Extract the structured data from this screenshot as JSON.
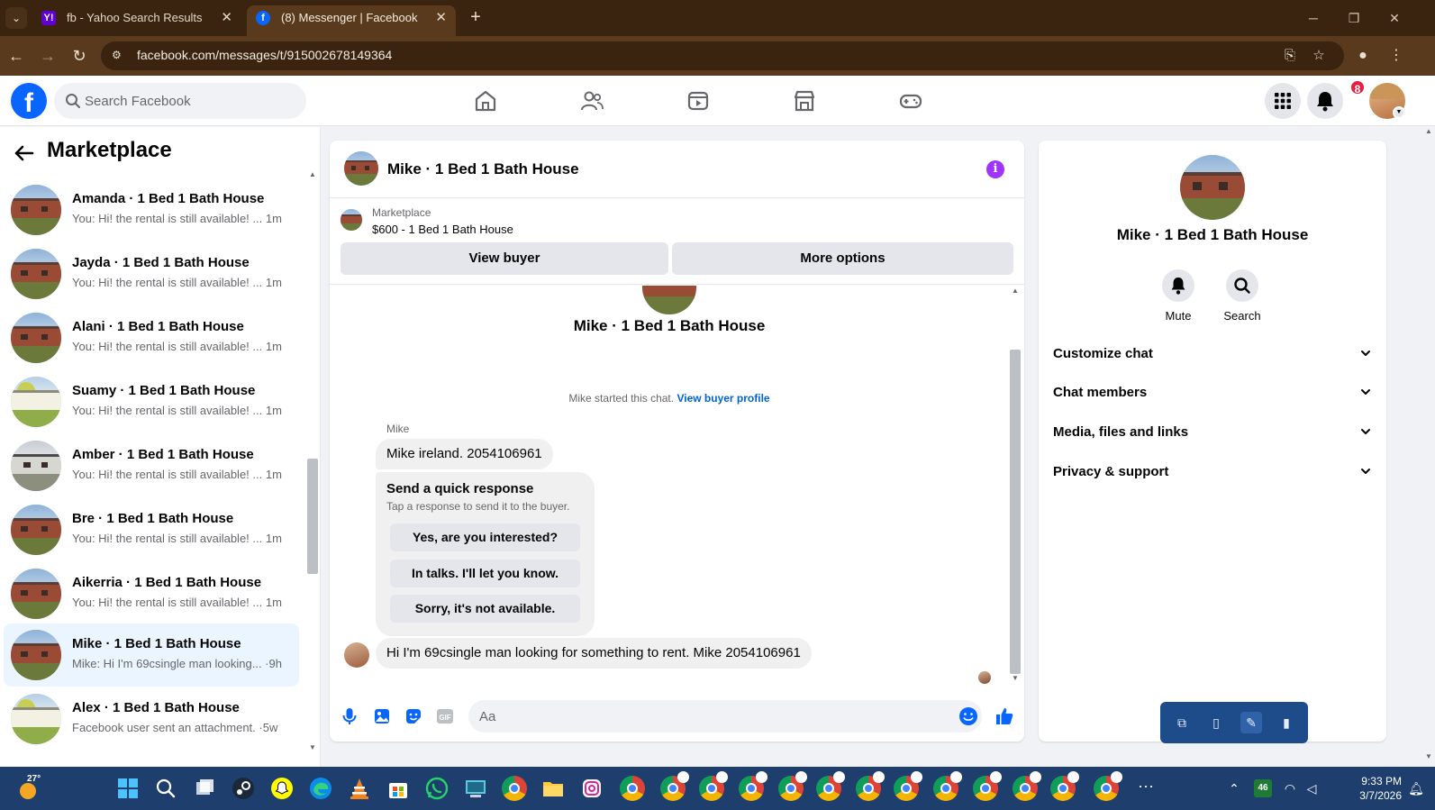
{
  "browser": {
    "tabs": [
      {
        "title": "fb - Yahoo Search Results",
        "favicon": "Y!"
      },
      {
        "title": "(8) Messenger | Facebook",
        "favicon": "f"
      }
    ],
    "url": "facebook.com/messages/t/915002678149364"
  },
  "header": {
    "logo": "f",
    "search_placeholder": "Search Facebook",
    "notification_count": "8"
  },
  "sidebar": {
    "title": "Marketplace",
    "conversations": [
      {
        "name": "Amanda · 1 Bed 1 Bath House",
        "preview": "You: Hi! the rental is still available! ... 1m"
      },
      {
        "name": "Jayda · 1 Bed 1 Bath House",
        "preview": "You: Hi! the rental is still available! ... 1m"
      },
      {
        "name": "Alani · 1 Bed 1 Bath House",
        "preview": "You: Hi! the rental is still available! ... 1m"
      },
      {
        "name": "Suamy · 1 Bed 1 Bath House",
        "preview": "You: Hi! the rental is still available! ... 1m"
      },
      {
        "name": "Amber · 1 Bed 1 Bath House",
        "preview": "You: Hi! the rental is still available! ... 1m"
      },
      {
        "name": "Bre · 1 Bed 1 Bath House",
        "preview": "You: Hi! the rental is still available! ... 1m"
      },
      {
        "name": "Aikerria · 1 Bed 1 Bath House",
        "preview": "You: Hi! the rental is still available! ... 1m"
      },
      {
        "name": "Mike · 1 Bed 1 Bath House",
        "preview": "Mike: Hi I'm 69csingle man looking... ·9h"
      },
      {
        "name": "Alex · 1 Bed 1 Bath House",
        "preview": "Facebook user sent an attachment. ·5w"
      }
    ]
  },
  "chat": {
    "title": "Mike · 1 Bed 1 Bath House",
    "marketplace_label": "Marketplace",
    "listing": "$600 - 1 Bed 1 Bath House",
    "view_buyer": "View buyer",
    "more_options": "More options",
    "center_name": "Mike · 1 Bed 1 Bath House",
    "started_text": "Mike started this chat.",
    "view_buyer_profile": "View buyer profile",
    "sender": "Mike",
    "message1": "Mike ireland. 2054106961",
    "quick_title": "Send a quick response",
    "quick_sub": "Tap a response to send it to the buyer.",
    "quick_options": [
      "Yes, are you interested?",
      "In talks. I'll let you know.",
      "Sorry, it's not available."
    ],
    "message2": "Hi I'm 69csingle man looking for something to rent.  Mike 2054106961",
    "input_placeholder": "Aa"
  },
  "right_panel": {
    "name": "Mike · 1 Bed 1 Bath House",
    "mute": "Mute",
    "search": "Search",
    "sections": [
      "Customize chat",
      "Chat members",
      "Media, files and links",
      "Privacy & support"
    ]
  },
  "taskbar": {
    "temperature": "27°",
    "tray_badge": "46",
    "time": "9:33 PM",
    "date": "3/7/2026"
  },
  "colors": {
    "fb_blue": "#0866ff",
    "browser_frame": "#5a3a1c",
    "taskbar": "#1e3f6e",
    "selected_row": "#ebf5ff",
    "info_purple": "#a033ff"
  }
}
